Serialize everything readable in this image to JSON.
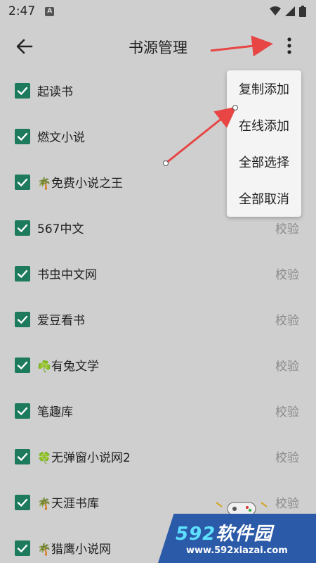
{
  "status": {
    "time": "2:47",
    "notif": "A"
  },
  "app_bar": {
    "title": "书源管理"
  },
  "sources": [
    {
      "name": "起读书",
      "emoji": ""
    },
    {
      "name": "燃文小说",
      "emoji": ""
    },
    {
      "name": "免费小说之王",
      "emoji": "🌴"
    },
    {
      "name": "567中文",
      "emoji": "",
      "action": "校验"
    },
    {
      "name": "书虫中文网",
      "emoji": "",
      "action": "校验"
    },
    {
      "name": "爱豆看书",
      "emoji": "",
      "action": "校验"
    },
    {
      "name": "有兔文学",
      "emoji": "☘️",
      "action": "校验"
    },
    {
      "name": "笔趣库",
      "emoji": "",
      "action": "校验"
    },
    {
      "name": "无弹窗小说网2",
      "emoji": "🍀",
      "action": "校验"
    },
    {
      "name": "天涯书库",
      "emoji": "🌴",
      "action": "校验"
    },
    {
      "name": "猎鹰小说网",
      "emoji": "🌴",
      "action": ""
    }
  ],
  "menu": {
    "items": [
      "复制添加",
      "在线添加",
      "全部选择",
      "全部取消"
    ]
  },
  "watermark": {
    "brand": "592软件园",
    "brand_num": "592",
    "brand_text": "软件园",
    "url": "www.592xiazai.com"
  },
  "colors": {
    "checkbox": "#1e7a5c",
    "arrow": "#e84545",
    "background": "#cfcfcf"
  }
}
